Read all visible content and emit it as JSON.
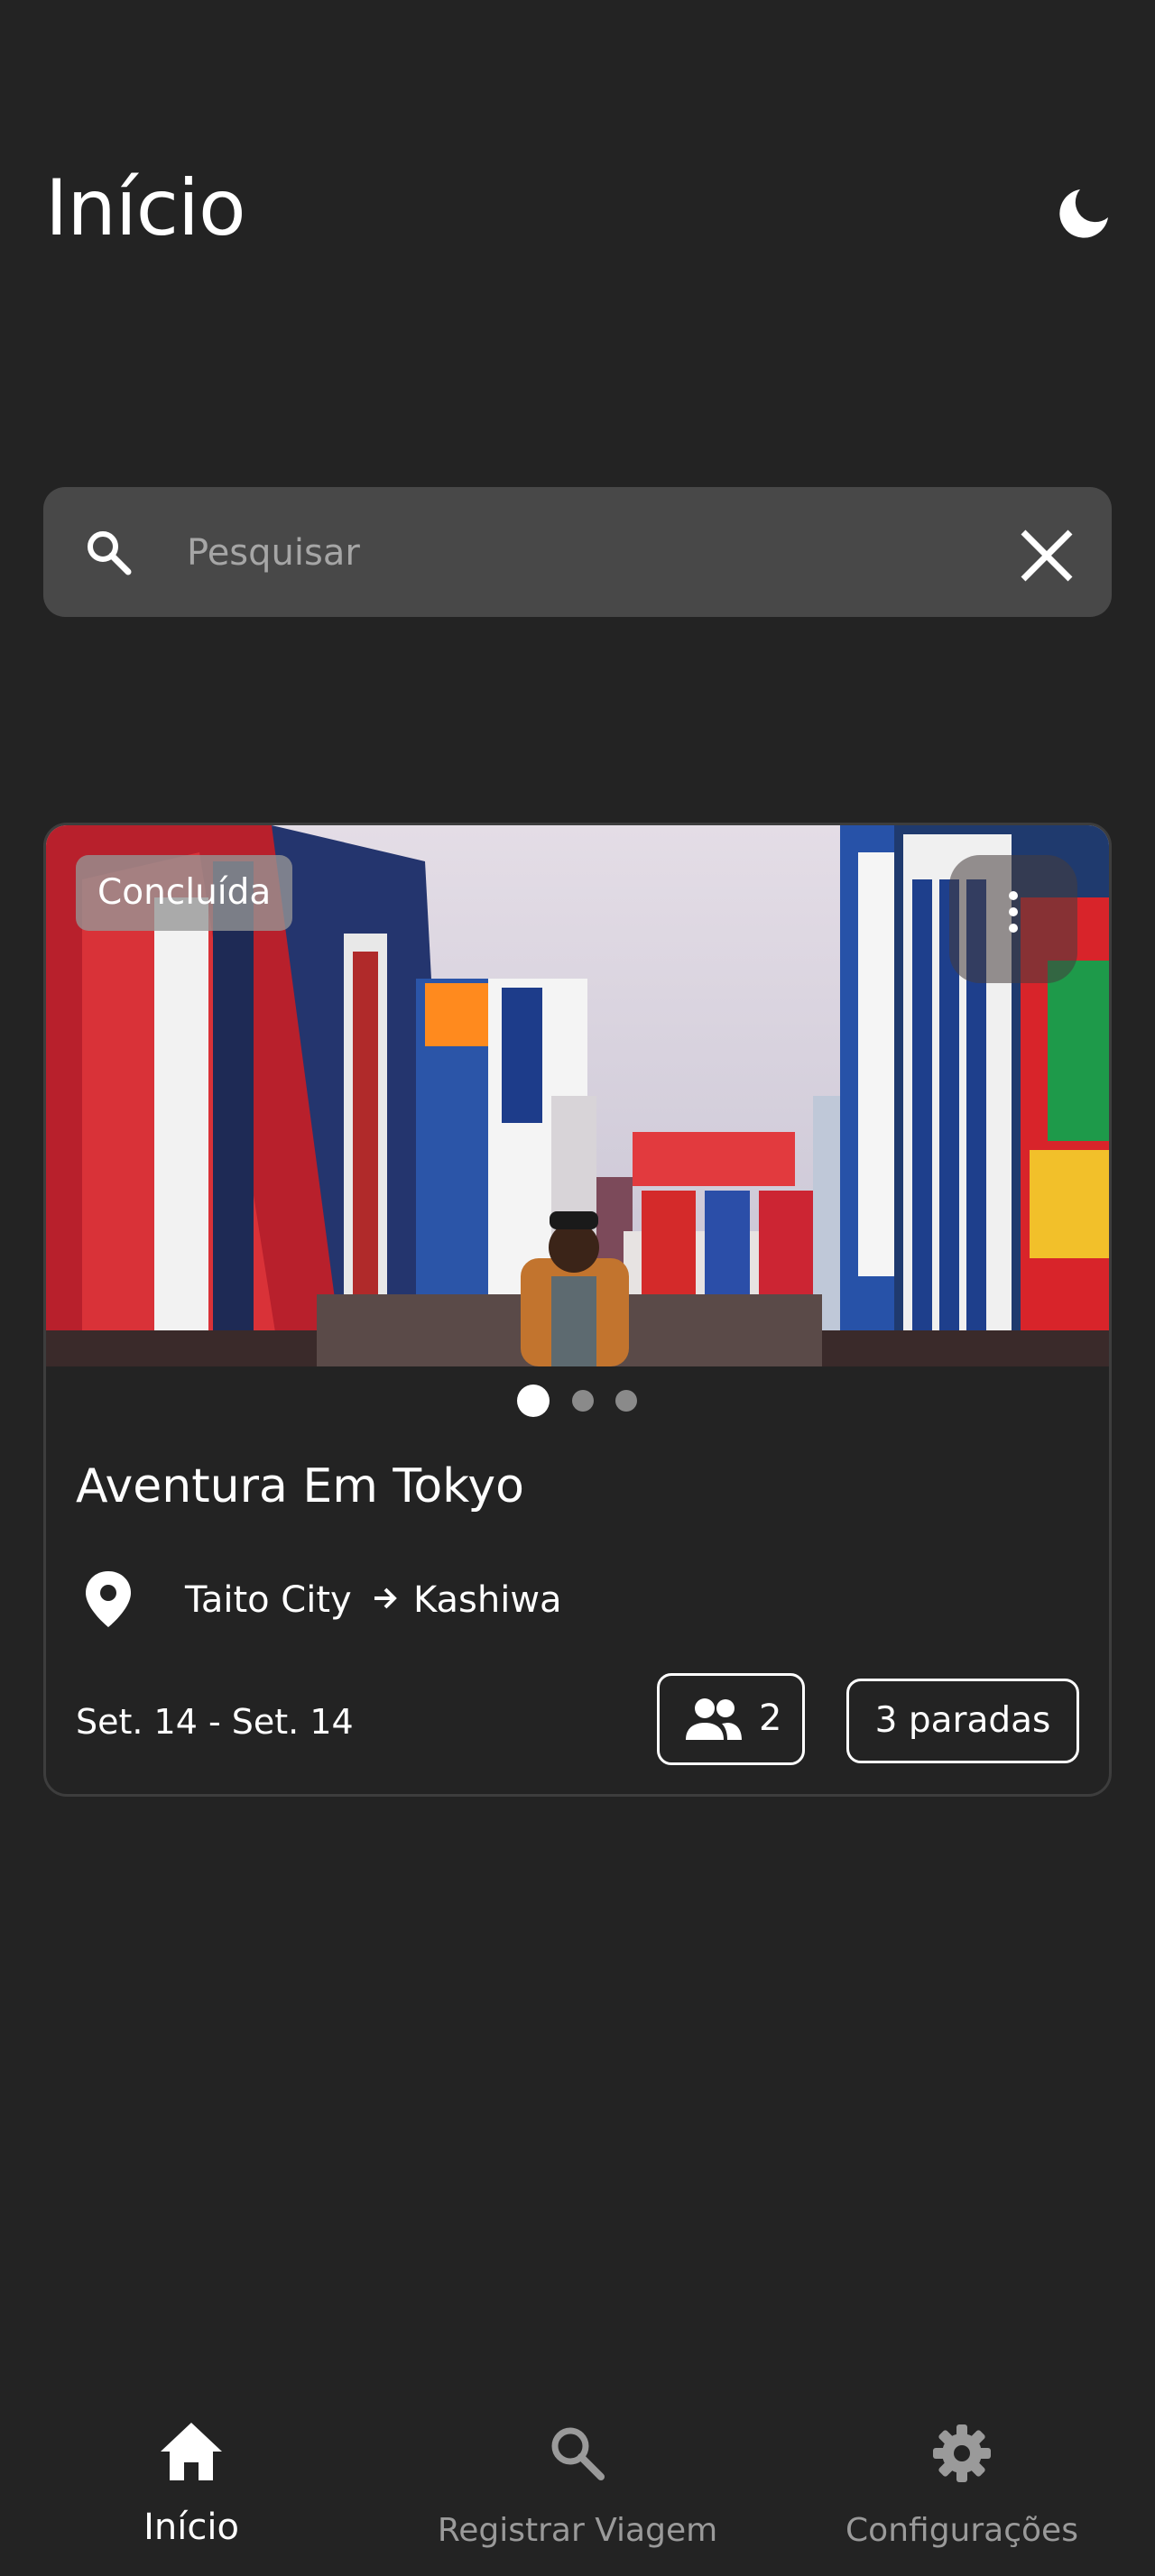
{
  "header": {
    "title": "Início",
    "theme_toggle_icon": "moon-icon"
  },
  "search": {
    "placeholder": "Pesquisar",
    "value": "",
    "search_icon": "search-icon",
    "clear_icon": "close-icon"
  },
  "trips": [
    {
      "status": "Concluída",
      "title": "Aventura Em Tokyo",
      "origin": "Taito City",
      "destination": "Kashiwa",
      "dates": "Set. 14 - Set. 14",
      "travelers": "2",
      "stops": "3 paradas",
      "carousel": {
        "total": 3,
        "active_index": 0
      },
      "image_subject": "city-street-photo"
    }
  ],
  "bottom_nav": {
    "items": [
      {
        "label": "Início",
        "icon": "home-icon",
        "active": true
      },
      {
        "label": "Registrar Viagem",
        "icon": "search-icon",
        "active": false
      },
      {
        "label": "Configurações",
        "icon": "gear-icon",
        "active": false
      }
    ]
  },
  "colors": {
    "background": "#232323",
    "search_bar": "#484848",
    "card_border": "#3d3d3d",
    "text_primary": "#ffffff",
    "text_muted": "#9a9a9a"
  }
}
